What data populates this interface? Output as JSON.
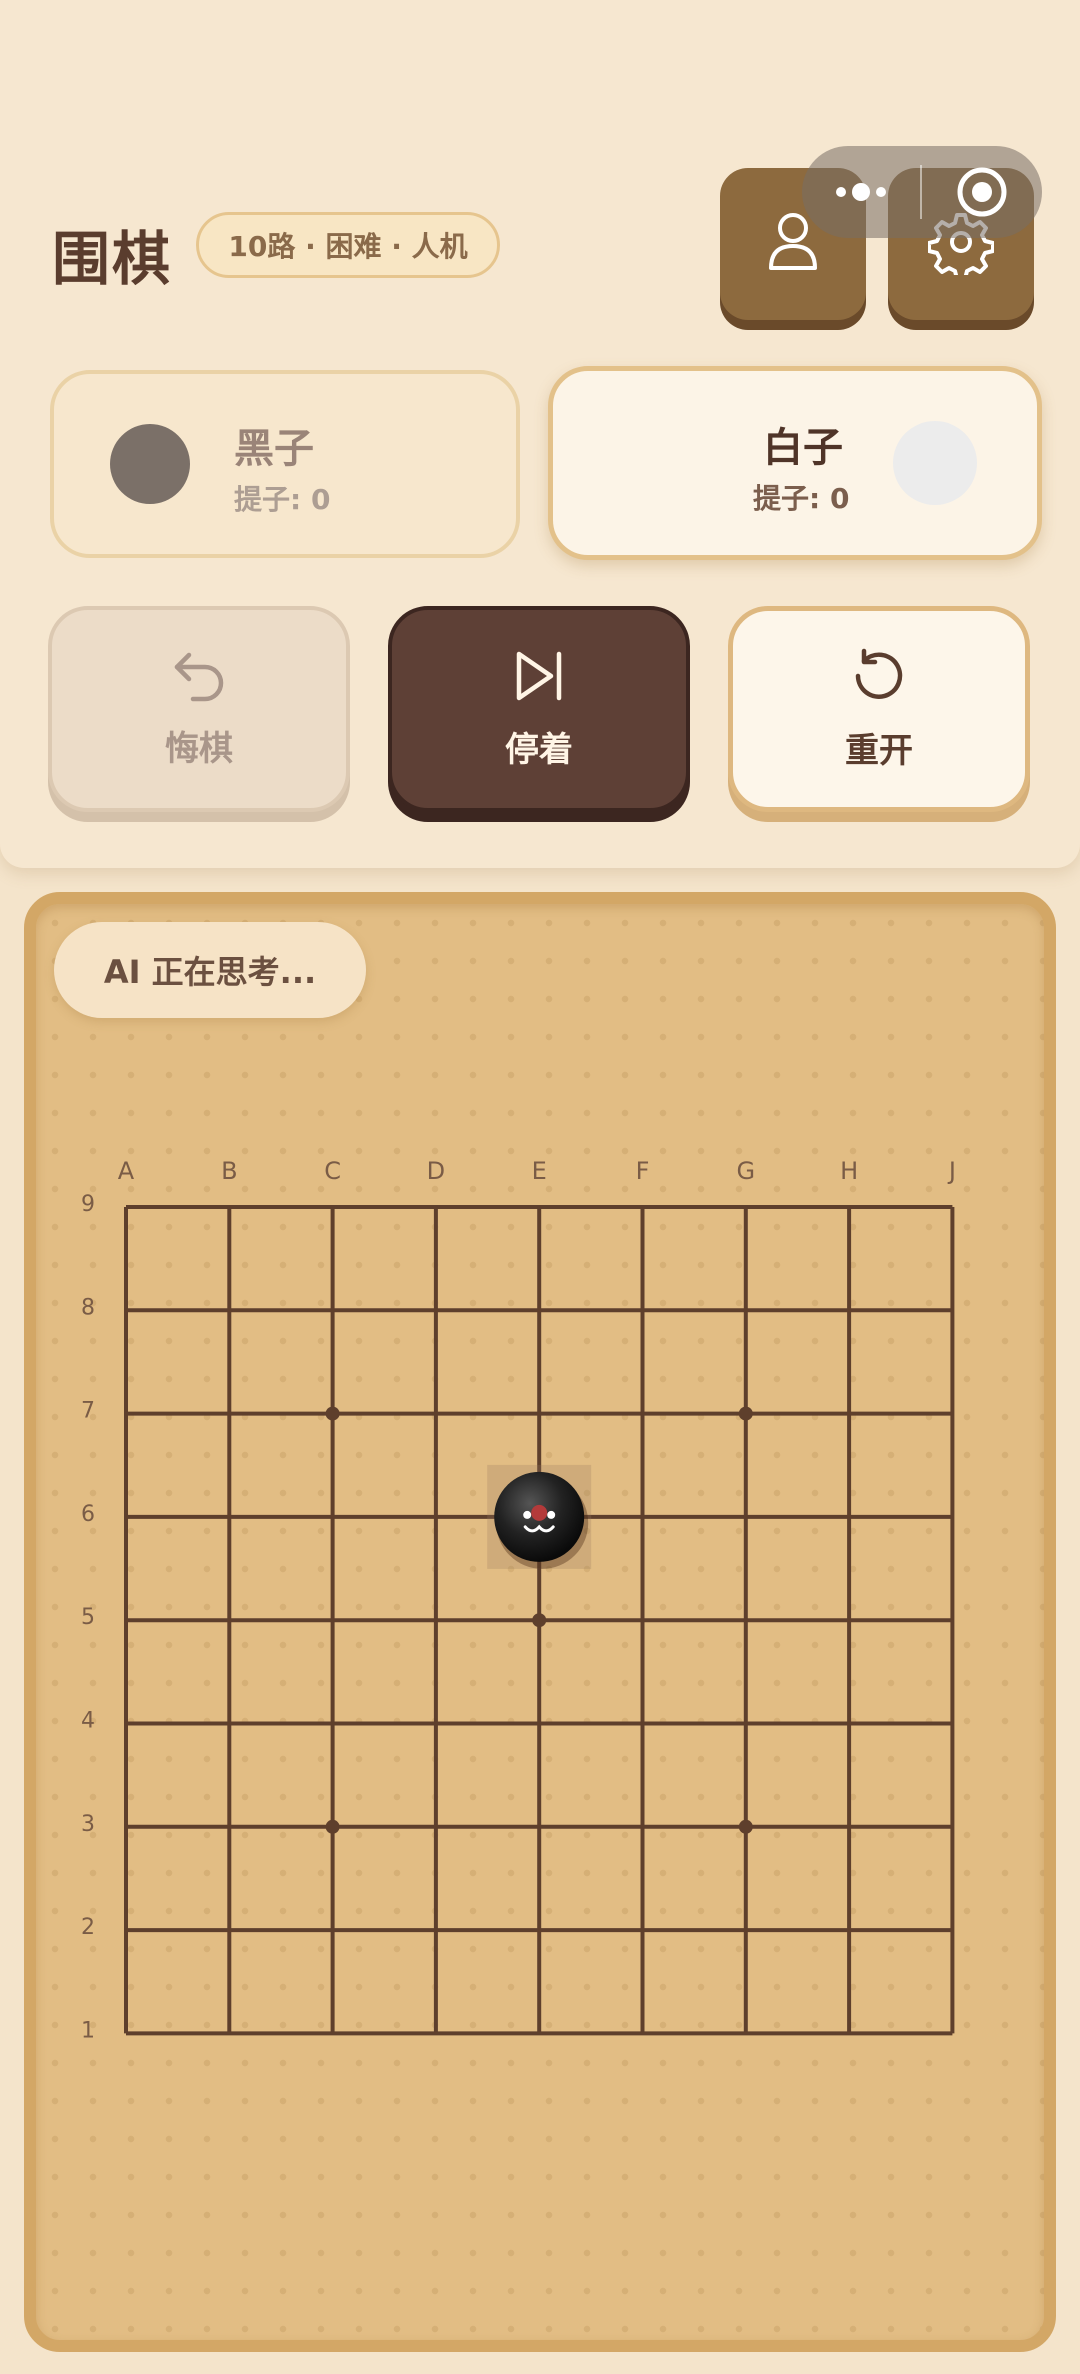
{
  "header": {
    "title": "围棋",
    "mode": "10路 · 困难 · 人机"
  },
  "top_buttons": [
    {
      "name": "profile",
      "icon": "user-icon"
    },
    {
      "name": "settings",
      "icon": "gear-icon"
    }
  ],
  "capsule": {
    "more_icon": "more-dots-icon",
    "close_icon": "record-icon"
  },
  "players": {
    "black": {
      "name": "黑子",
      "captures": "提子: 0",
      "color": "#7b7068"
    },
    "white": {
      "name": "白子",
      "captures": "提子: 0",
      "color": "#ececec"
    }
  },
  "actions": {
    "undo": {
      "label": "悔棋",
      "icon": "undo-icon"
    },
    "pass": {
      "label": "停着",
      "icon": "skip-icon"
    },
    "restart": {
      "label": "重开",
      "icon": "restart-icon"
    }
  },
  "status": {
    "thinking": "AI 正在思考..."
  },
  "board": {
    "columns": [
      "A",
      "B",
      "C",
      "D",
      "E",
      "F",
      "G",
      "H",
      "J"
    ],
    "rows": [
      "9",
      "8",
      "7",
      "6",
      "5",
      "4",
      "3",
      "2",
      "1"
    ],
    "star_points": [
      "C7",
      "G7",
      "E5",
      "C3",
      "G3"
    ],
    "stones": [
      {
        "point": "E6",
        "color": "black",
        "last_move": true
      }
    ],
    "colors": {
      "line": "#5e3f2c",
      "wood": "#e2bd84",
      "last_move_marker": "#b33a3a"
    }
  }
}
